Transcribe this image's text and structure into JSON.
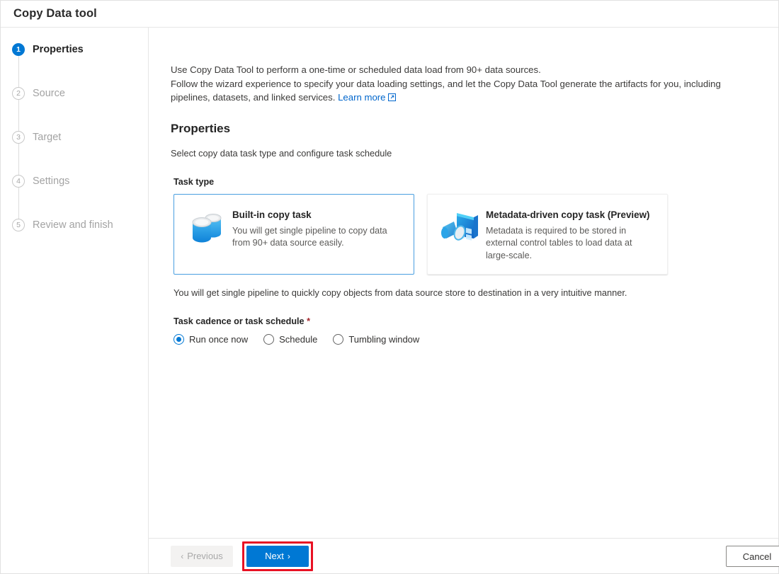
{
  "window": {
    "title": "Copy Data tool"
  },
  "sidebar": {
    "steps": [
      {
        "number": "1",
        "label": "Properties",
        "state": "active"
      },
      {
        "number": "2",
        "label": "Source",
        "state": "inactive"
      },
      {
        "number": "3",
        "label": "Target",
        "state": "inactive"
      },
      {
        "number": "4",
        "label": "Settings",
        "state": "inactive"
      },
      {
        "number": "5",
        "label": "Review and finish",
        "state": "inactive"
      }
    ]
  },
  "main": {
    "intro_line1": "Use Copy Data Tool to perform a one-time or scheduled data load from 90+ data sources.",
    "intro_line2": "Follow the wizard experience to specify your data loading settings, and let the Copy Data Tool generate the artifacts for you, including pipelines, datasets, and linked services.",
    "learn_more_label": "Learn more",
    "section_title": "Properties",
    "section_subtitle": "Select copy data task type and configure task schedule",
    "task_type_label": "Task type",
    "cards": [
      {
        "title": "Built-in copy task",
        "description": "You will get single pipeline to copy data from 90+ data source easily.",
        "icon": "database-cylinders-icon",
        "selected": true
      },
      {
        "title": "Metadata-driven copy task (Preview)",
        "description": "Metadata is required to be stored in external control tables to load data at large-scale.",
        "icon": "metadata-table-magnifier-icon",
        "selected": false
      }
    ],
    "helper_text": "You will get single pipeline to quickly copy objects from data source store to destination in a very intuitive manner.",
    "cadence_label": "Task cadence or task schedule",
    "cadence_required_marker": "*",
    "cadence_options": [
      {
        "label": "Run once now",
        "checked": true
      },
      {
        "label": "Schedule",
        "checked": false
      },
      {
        "label": "Tumbling window",
        "checked": false
      }
    ]
  },
  "footer": {
    "previous_label": "Previous",
    "next_label": "Next",
    "cancel_label": "Cancel",
    "previous_chevron": "‹",
    "next_chevron": "›"
  },
  "colors": {
    "accent": "#0078d4",
    "selected_card_border": "#4a9fe0",
    "highlight_box": "#e81123",
    "required_star": "#a4262c",
    "link": "#0066cc"
  }
}
